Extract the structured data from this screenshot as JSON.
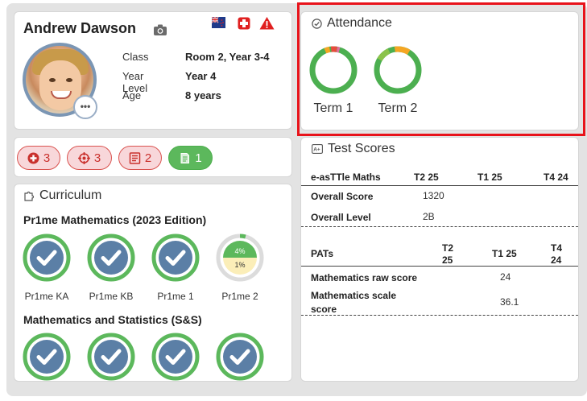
{
  "profile": {
    "name": "Andrew Dawson",
    "fields": [
      {
        "label": "Class",
        "value": "Room 2, Year 3-4"
      },
      {
        "label": "Year Level",
        "value": "Year 4"
      },
      {
        "label": "Age",
        "value": "8 years"
      }
    ],
    "more": "•••"
  },
  "badges": [
    {
      "icon": "medical-plus-icon",
      "count": "3",
      "color": "#d9534f"
    },
    {
      "icon": "target-icon",
      "count": "3",
      "color": "#d9534f"
    },
    {
      "icon": "document-icon",
      "count": "2",
      "color": "#d9534f"
    },
    {
      "icon": "note-icon",
      "count": "1",
      "color": "#5cb85c"
    }
  ],
  "curriculum": {
    "title": "Curriculum",
    "sections": [
      {
        "title": "Pr1me Mathematics (2023 Edition)",
        "items": [
          {
            "label": "Pr1me KA",
            "status": "complete"
          },
          {
            "label": "Pr1me KB",
            "status": "complete"
          },
          {
            "label": "Pr1me 1",
            "status": "complete"
          },
          {
            "label": "Pr1me 2",
            "status": "in-progress",
            "progress_green": "4%",
            "progress_yellow": "1%"
          }
        ]
      },
      {
        "title": "Mathematics and Statistics (S&S)",
        "items": [
          {
            "label": "",
            "status": "complete"
          },
          {
            "label": "",
            "status": "complete"
          },
          {
            "label": "",
            "status": "complete"
          },
          {
            "label": "",
            "status": "complete"
          }
        ]
      }
    ]
  },
  "attendance": {
    "title": "Attendance",
    "terms": [
      {
        "label": "Term 1"
      },
      {
        "label": "Term 2"
      }
    ]
  },
  "tests": {
    "title": "Test Scores",
    "easttle": {
      "title": "e-asTTle Maths",
      "columns": [
        "T2 25",
        "T1 25",
        "T4 24"
      ],
      "rows": [
        {
          "label": "Overall Score",
          "t2_25": "1320"
        },
        {
          "label": "Overall Level",
          "t2_25": "2B"
        }
      ]
    },
    "pats": {
      "title": "PATs",
      "col1a": "T2",
      "col1b": "25",
      "col2": "T1 25",
      "col3a": "T4",
      "col3b": "24",
      "rows": [
        {
          "label": "Mathematics raw score",
          "value": "24"
        },
        {
          "label_a": "Mathematics scale",
          "label_b": "score",
          "value": "36.1"
        }
      ]
    }
  },
  "colors": {
    "accent_blue": "#5b7fa6",
    "green": "#5cb85c",
    "red": "#d9534f",
    "highlight": "#e8131b"
  }
}
